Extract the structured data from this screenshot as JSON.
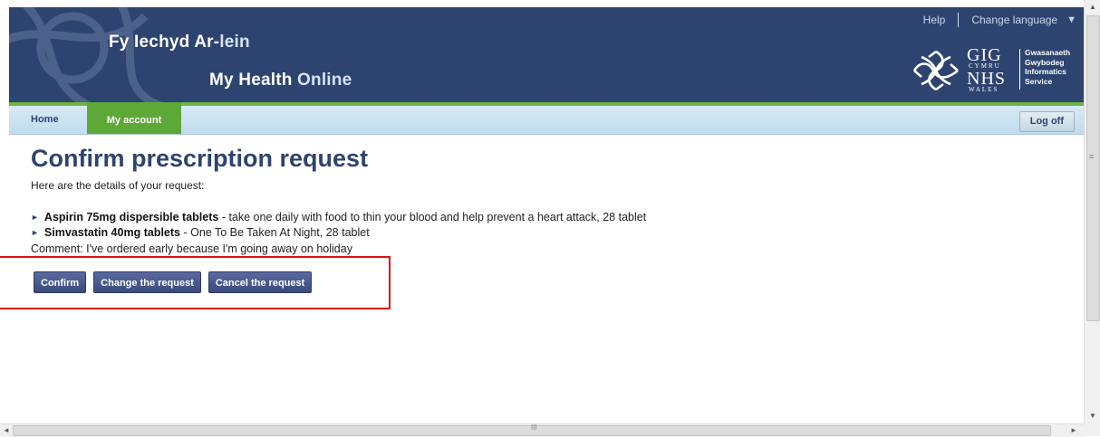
{
  "header": {
    "brand_welsh_a": "Fy Iechyd Ar-",
    "brand_welsh_b": "lein",
    "brand_en_a": "My Health ",
    "brand_en_b": "Online",
    "help_label": "Help",
    "change_language_label": "Change language",
    "nhs_logo": {
      "gig": "GIG",
      "cymru": "CYMRU",
      "nhs": "NHS",
      "wales": "WALES",
      "service_lines": [
        "Gwasanaeth",
        "Gwybodeg",
        "Informatics",
        "Service"
      ]
    }
  },
  "nav": {
    "home_label": "Home",
    "account_label": "My account",
    "logoff_label": "Log off"
  },
  "main": {
    "title": "Confirm prescription request",
    "intro": "Here are the details of your request:",
    "items": [
      {
        "name": "Aspirin 75mg dispersible tablets",
        "detail": " - take one daily with food to thin your blood and help prevent a heart attack, 28 tablet"
      },
      {
        "name": "Simvastatin 40mg tablets",
        "detail": " - One To Be Taken At Night, 28 tablet"
      }
    ],
    "comment": "Comment: I've ordered early because I'm going away on holiday",
    "buttons": {
      "confirm": "Confirm",
      "change": "Change the request",
      "cancel": "Cancel the request"
    }
  },
  "colors": {
    "header_bg": "#2e4470",
    "accent_green": "#5ea838",
    "title_blue": "#2e4470",
    "highlight_red": "#e01010"
  }
}
